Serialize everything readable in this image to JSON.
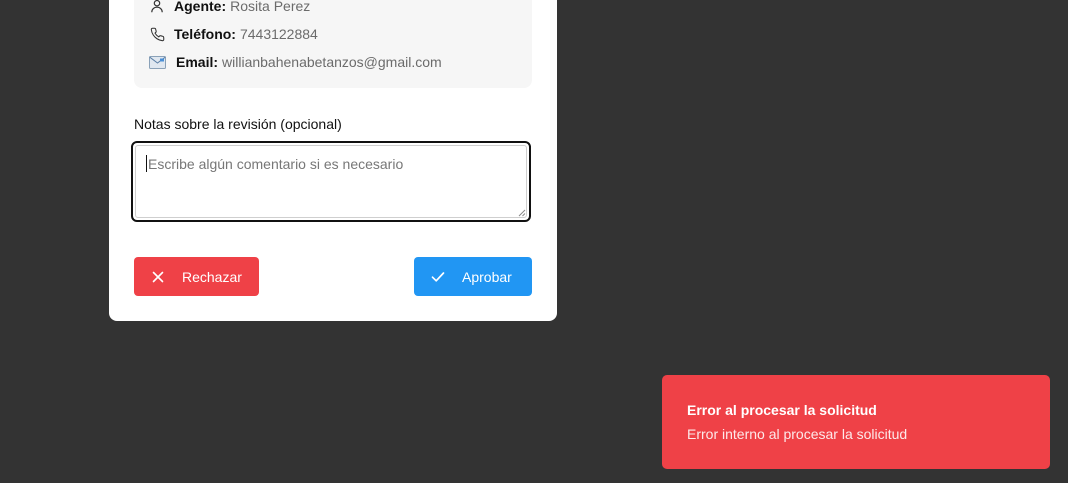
{
  "contact": {
    "agent_label": "Agente:",
    "agent_value": "Rosita Perez",
    "phone_label": "Teléfono:",
    "phone_value": "7443122884",
    "email_label": "Email:",
    "email_value": "willianbahenabetanzos@gmail.com"
  },
  "notes": {
    "label": "Notas sobre la revisión (opcional)",
    "placeholder": "Escribe algún comentario si es necesario",
    "value": ""
  },
  "actions": {
    "reject_label": "Rechazar",
    "approve_label": "Aprobar"
  },
  "toast": {
    "title": "Error al procesar la solicitud",
    "detail": "Error interno al procesar la solicitud"
  },
  "colors": {
    "reject": "#ef4147",
    "approve": "#2196f3",
    "toast": "#ef4147",
    "backdrop": "#333333"
  },
  "icons": {
    "agent": "user-icon",
    "phone": "phone-icon",
    "email": "envelope-icon",
    "reject": "x-icon",
    "approve": "check-icon"
  }
}
